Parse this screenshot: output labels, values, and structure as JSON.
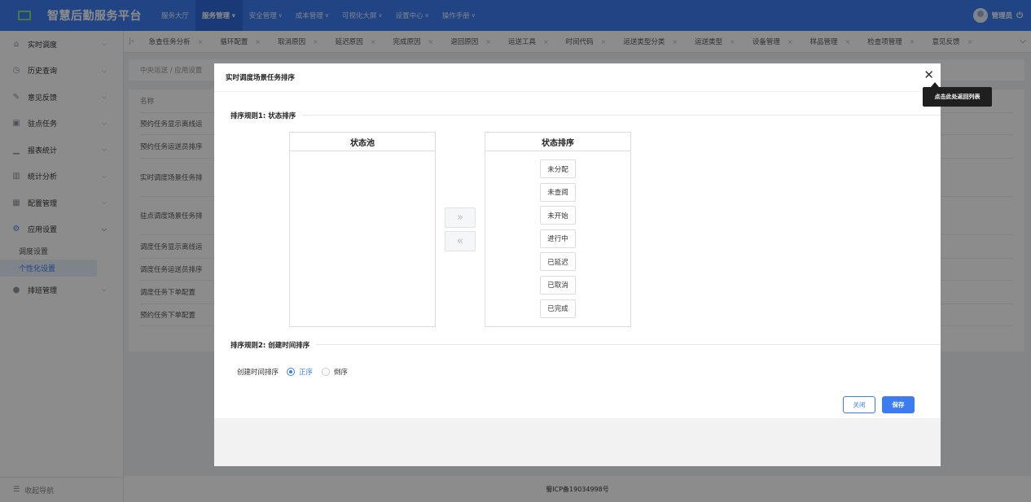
{
  "app": {
    "title": "智慧后勤服务平台"
  },
  "topnav": [
    {
      "label": "服务大厅",
      "chevron": false,
      "active": false
    },
    {
      "label": "服务管理",
      "chevron": true,
      "active": true
    },
    {
      "label": "安全管理",
      "chevron": true,
      "active": false
    },
    {
      "label": "成本管理",
      "chevron": true,
      "active": false
    },
    {
      "label": "可视化大屏",
      "chevron": true,
      "active": false
    },
    {
      "label": "设置中心",
      "chevron": true,
      "active": false
    },
    {
      "label": "操作手册",
      "chevron": true,
      "active": false
    }
  ],
  "user": {
    "name": "管理员"
  },
  "sidebar": {
    "items": [
      {
        "label": "实时调度",
        "icon": "home-icon"
      },
      {
        "label": "历史查询",
        "icon": "history-icon"
      },
      {
        "label": "意见反馈",
        "icon": "feedback-icon"
      },
      {
        "label": "驻点任务",
        "icon": "station-task-icon"
      },
      {
        "label": "报表统计",
        "icon": "report-icon"
      },
      {
        "label": "统计分析",
        "icon": "analysis-icon"
      },
      {
        "label": "配置管理",
        "icon": "config-icon"
      },
      {
        "label": "应用设置",
        "icon": "app-settings-icon"
      }
    ],
    "subitems": [
      {
        "label": "调度设置",
        "active": false
      },
      {
        "label": "个性化设置",
        "active": true
      }
    ],
    "last_item": {
      "label": "排班管理",
      "icon": "schedule-icon"
    },
    "collapse_label": "收起导航"
  },
  "tabs": [
    "急查任务分析",
    "循环配置",
    "取消原因",
    "延迟原因",
    "完成原因",
    "退回原因",
    "运送工具",
    "时间代码",
    "运送类型分类",
    "运送类型",
    "设备管理",
    "样品管理",
    "检查项管理",
    "意见反馈"
  ],
  "breadcrumb": "中央运送 / 应用设置",
  "table": {
    "header": "名称",
    "rows": [
      "预约任务显示离线运",
      "预约任务运送员排序",
      "实时调度场景任务排",
      "驻点调度场景任务排",
      "调度任务显示离线运",
      "调度任务运送员排序",
      "调度任务下单配置",
      "预约任务下单配置"
    ]
  },
  "dialog": {
    "title": "实时调度场景任务排序",
    "tooltip": "点击此处返回列表",
    "rule1_title": "排序规则1: 状态排序",
    "pool_title": "状态池",
    "sort_title": "状态排序",
    "statuses": [
      "未分配",
      "未查阅",
      "未开始",
      "进行中",
      "已延迟",
      "已取消",
      "已完成"
    ],
    "move_right": "»",
    "move_left": "«",
    "rule2_title": "排序规则2: 创建时间排序",
    "time_sort_label": "创建时间排序",
    "asc_label": "正序",
    "desc_label": "倒序",
    "close_label": "关闭",
    "save_label": "保存"
  },
  "footer": {
    "icp": "蜀ICP备19034998号"
  }
}
